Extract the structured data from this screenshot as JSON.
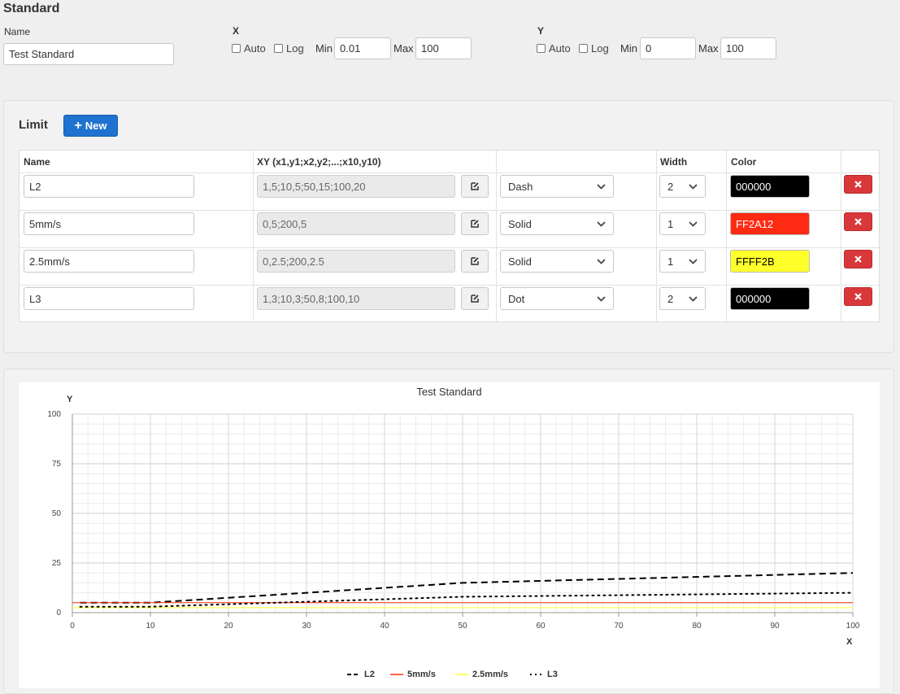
{
  "standard": {
    "title": "Standard",
    "name_label": "Name",
    "name_value": "Test Standard"
  },
  "x_axis": {
    "label": "X",
    "auto_label": "Auto",
    "auto": false,
    "log_label": "Log",
    "log": false,
    "min_label": "Min",
    "min": "0.01",
    "max_label": "Max",
    "max": "100"
  },
  "y_axis": {
    "label": "Y",
    "auto_label": "Auto",
    "auto": false,
    "log_label": "Log",
    "log": false,
    "min_label": "Min",
    "min": "0",
    "max_label": "Max",
    "max": "100"
  },
  "limit": {
    "title": "Limit",
    "new_button": "New",
    "columns": {
      "name": "Name",
      "xy": "XY (x1,y1;x2,y2;...;x10,y10)",
      "style": "",
      "width": "Width",
      "color": "Color"
    },
    "rows": [
      {
        "name": "L2",
        "xy": "1,5;10,5;50,15;100,20",
        "style": "Dash",
        "width": "2",
        "color": "000000",
        "color_hex": "#000000",
        "text_color": "#ffffff"
      },
      {
        "name": "5mm/s",
        "xy": "0,5;200,5",
        "style": "Solid",
        "width": "1",
        "color": "FF2A12",
        "color_hex": "#FF2A12",
        "text_color": "#ffffff"
      },
      {
        "name": "2.5mm/s",
        "xy": "0,2.5;200,2.5",
        "style": "Solid",
        "width": "1",
        "color": "FFFF2B",
        "color_hex": "#FFFF2B",
        "text_color": "#000000"
      },
      {
        "name": "L3",
        "xy": "1,3;10,3;50,8;100,10",
        "style": "Dot",
        "width": "2",
        "color": "000000",
        "color_hex": "#000000",
        "text_color": "#ffffff"
      }
    ]
  },
  "chart_data": {
    "type": "line",
    "title": "Test Standard",
    "xlabel": "X",
    "ylabel": "Y",
    "xlim": [
      0,
      100
    ],
    "ylim": [
      0,
      100
    ],
    "x_ticks": [
      0,
      10,
      20,
      30,
      40,
      50,
      60,
      70,
      80,
      90,
      100
    ],
    "y_ticks": [
      0,
      25,
      50,
      75,
      100
    ],
    "grid": true,
    "legend_position": "bottom",
    "series": [
      {
        "name": "L2",
        "color": "#000000",
        "style": "dash",
        "width": 2,
        "points": [
          [
            1,
            5
          ],
          [
            10,
            5
          ],
          [
            50,
            15
          ],
          [
            100,
            20
          ]
        ]
      },
      {
        "name": "5mm/s",
        "color": "#FF2A12",
        "style": "solid",
        "width": 1,
        "points": [
          [
            0,
            5
          ],
          [
            200,
            5
          ]
        ]
      },
      {
        "name": "2.5mm/s",
        "color": "#FFFF2B",
        "style": "solid",
        "width": 1,
        "points": [
          [
            0,
            2.5
          ],
          [
            200,
            2.5
          ]
        ]
      },
      {
        "name": "L3",
        "color": "#000000",
        "style": "dot",
        "width": 2,
        "points": [
          [
            1,
            3
          ],
          [
            10,
            3
          ],
          [
            50,
            8
          ],
          [
            100,
            10
          ]
        ]
      }
    ]
  }
}
